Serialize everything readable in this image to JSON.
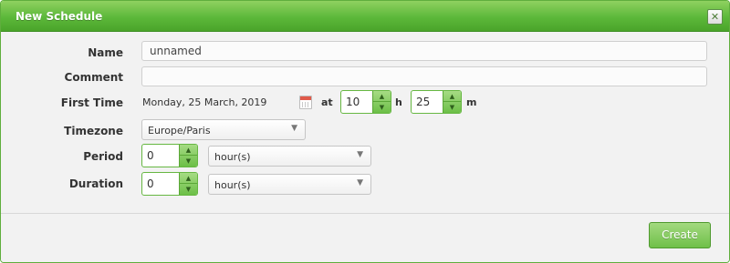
{
  "dialog": {
    "title": "New Schedule",
    "close_symbol": "✕"
  },
  "form": {
    "name": {
      "label": "Name",
      "value": "unnamed"
    },
    "comment": {
      "label": "Comment",
      "value": ""
    },
    "first_time": {
      "label": "First Time",
      "date": "Monday, 25 March, 2019",
      "at_label": "at",
      "hour_value": "10",
      "hour_unit": "h",
      "minute_value": "25",
      "minute_unit": "m"
    },
    "timezone": {
      "label": "Timezone",
      "value": "Europe/Paris"
    },
    "period": {
      "label": "Period",
      "value": "0",
      "unit": "hour(s)"
    },
    "duration": {
      "label": "Duration",
      "value": "0",
      "unit": "hour(s)"
    }
  },
  "icons": {
    "calendar": "calendar-icon",
    "spin_up": "▲",
    "spin_down": "▼",
    "caret": "▼"
  },
  "footer": {
    "create_label": "Create"
  },
  "colors": {
    "title_bar": "#5cb83a",
    "border": "#5fae3d",
    "background": "#f2f2f2",
    "button_green": "#6fc049"
  }
}
